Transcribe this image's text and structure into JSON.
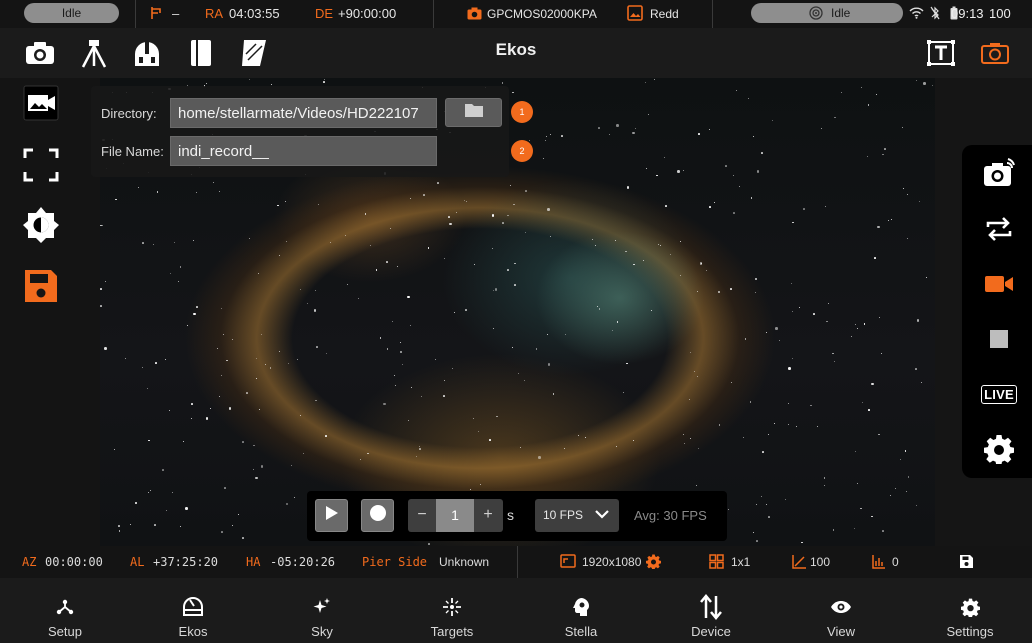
{
  "status_bar": {
    "left_state": "Idle",
    "mount_dash": "–",
    "ra_label": "RA",
    "ra_value": "04:03:55",
    "de_label": "DE",
    "de_value": "+90:00:00",
    "camera_name": "GPCMOS02000KPA",
    "app_short": "Redd",
    "right_state": "Idle",
    "time": "09:13",
    "battery": "100"
  },
  "toolbar": {
    "title": "Ekos",
    "icons": [
      "camera-icon",
      "tripod-icon",
      "observatory-icon",
      "notebook-icon",
      "filter-icon",
      "text-overlay-icon",
      "camera-frame-icon"
    ]
  },
  "recording": {
    "directory_label": "Directory:",
    "directory_value": "home/stellarmate/Videos/HD222107",
    "filename_label": "File Name:",
    "filename_value": "indi_record__",
    "badge_1": "1",
    "badge_2": "2"
  },
  "right_rail": {
    "live_label": "LIVE"
  },
  "stream": {
    "step_minus": "−",
    "step_value": "1",
    "step_plus": "+",
    "step_unit": "s",
    "fps_selected": "10 FPS",
    "avg_text": "Avg: 30  FPS"
  },
  "info_bar": {
    "az_label": "AZ",
    "az_value": "00:00:00",
    "al_label": "AL",
    "al_value": "+37:25:20",
    "ha_label": "HA",
    "ha_value": "-05:20:26",
    "pier_label": "Pier Side",
    "pier_value": "Unknown",
    "resolution": "1920x1080",
    "binning": "1x1",
    "gain": "100",
    "offset": "0"
  },
  "bottom_nav": {
    "items": [
      {
        "label": "Setup",
        "icon": "setup-icon"
      },
      {
        "label": "Ekos",
        "icon": "ekos-icon"
      },
      {
        "label": "Sky",
        "icon": "sky-icon"
      },
      {
        "label": "Targets",
        "icon": "targets-icon"
      },
      {
        "label": "Stella",
        "icon": "stella-icon"
      },
      {
        "label": "Device",
        "icon": "device-icon"
      },
      {
        "label": "View",
        "icon": "view-icon"
      },
      {
        "label": "Settings",
        "icon": "settings-icon"
      }
    ]
  },
  "colors": {
    "accent": "#f26b1d",
    "background": "#151515",
    "panel": "#1b1b1b"
  }
}
